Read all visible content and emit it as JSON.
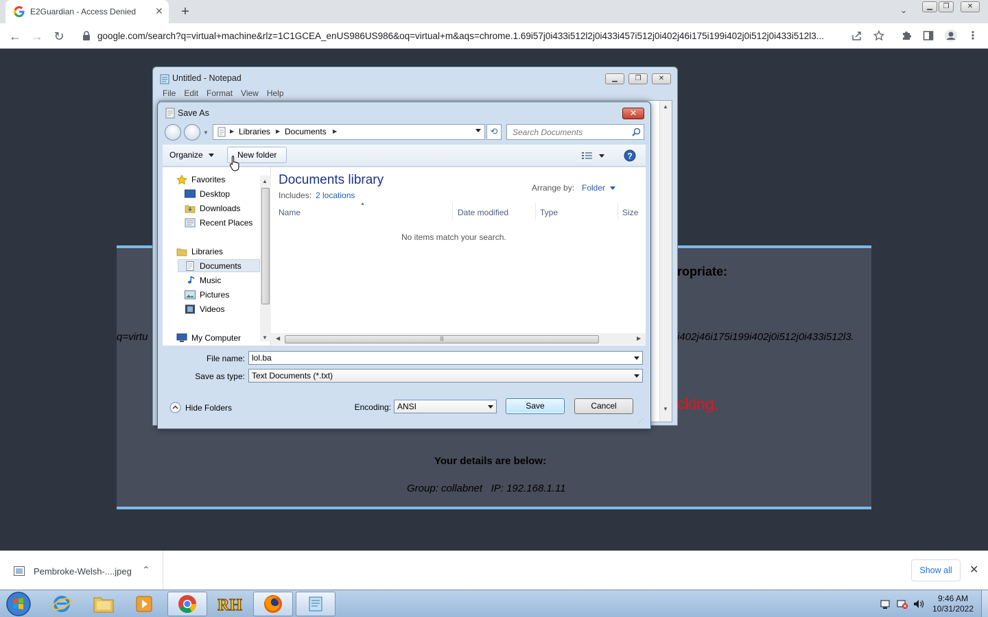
{
  "browser": {
    "tab_title": "E2Guardian - Access Denied",
    "new_tab_label": "+",
    "url": "google.com/search?q=virtual+machine&rlz=1C1GCEA_enUS986US986&oq=virtual+m&aqs=chrome.1.69i57j0i433i512l2j0i433i457i512j0i402j46i175i199i402j0i512j0i433i512l3..."
  },
  "page": {
    "heading_fragment": "ropriate:",
    "url_left_fragment": "q=virtu",
    "url_right_fragment": "i402j46i175i199i402j0i512j0i433i512l3.",
    "red_fragment": "cking.",
    "details_heading": "Your details are below:",
    "details_line": "Group: collabnet   IP: 192.168.1.11"
  },
  "notepad": {
    "title": "Untitled - Notepad",
    "menu": [
      "File",
      "Edit",
      "Format",
      "View",
      "Help"
    ]
  },
  "save_dialog": {
    "title": "Save As",
    "breadcrumb": [
      "Libraries",
      "Documents"
    ],
    "search_placeholder": "Search Documents",
    "organize_label": "Organize",
    "new_folder_label": "New folder",
    "nav": {
      "favorites_label": "Favorites",
      "favorites": [
        "Desktop",
        "Downloads",
        "Recent Places"
      ],
      "libraries_label": "Libraries",
      "libraries": [
        "Documents",
        "Music",
        "Pictures",
        "Videos"
      ],
      "computer_label": "My Computer",
      "selected": "Documents"
    },
    "library_title": "Documents library",
    "includes_label": "Includes:",
    "includes_link": "2 locations",
    "arrange_label": "Arrange by:",
    "arrange_value": "Folder",
    "columns": [
      "Name",
      "Date modified",
      "Type",
      "Size"
    ],
    "empty_message": "No items match your search.",
    "file_name_label": "File name:",
    "file_name_value": "lol.ba",
    "save_type_label": "Save as type:",
    "save_type_value": "Text Documents (*.txt)",
    "hide_folders_label": "Hide Folders",
    "encoding_label": "Encoding:",
    "encoding_value": "ANSI",
    "save_label": "Save",
    "cancel_label": "Cancel"
  },
  "download_bar": {
    "file_name": "Pembroke-Welsh-....jpeg",
    "show_all_label": "Show all"
  },
  "taskbar": {
    "time": "9:46 AM",
    "date": "10/31/2022"
  },
  "colors": {
    "page_bg": "#2e3540",
    "panel_bg": "#474d5a",
    "panel_border": "#7fb9e6",
    "blocked_red": "#e8151b",
    "library_title": "#1e3287"
  }
}
